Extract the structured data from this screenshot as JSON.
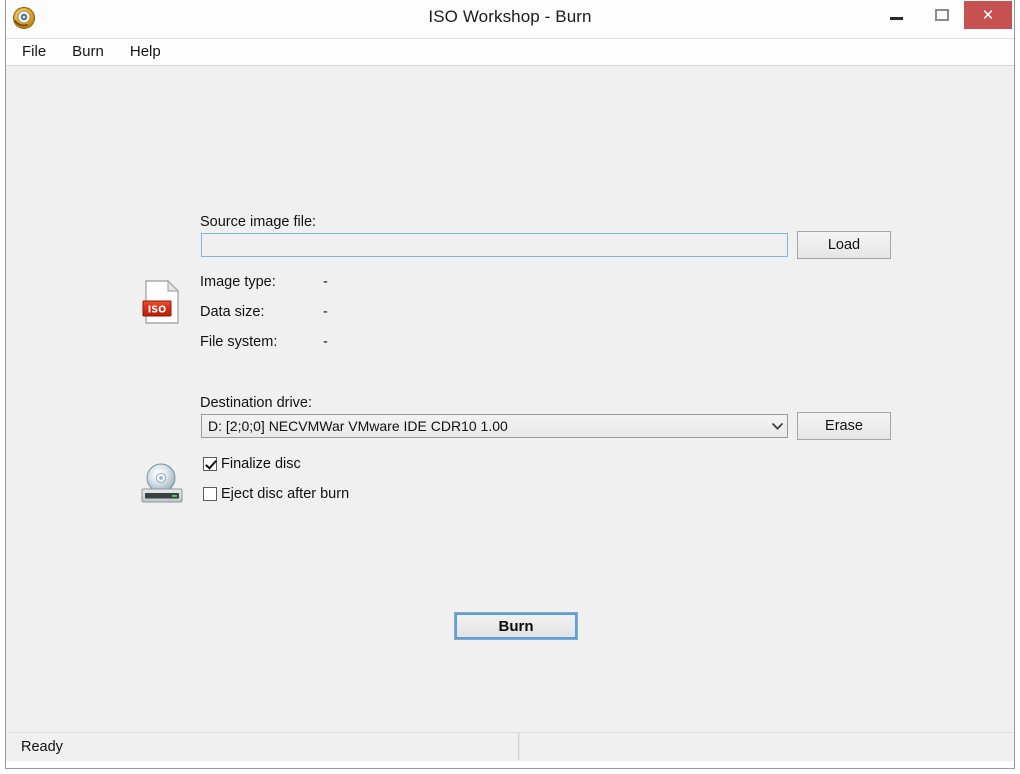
{
  "window": {
    "title": "ISO Workshop - Burn",
    "app_icon": "iso-workshop-logo-icon",
    "controls": {
      "minimize": "minimize-icon",
      "maximize": "maximize-icon",
      "close": "✕"
    },
    "close_button_color": "#c75050"
  },
  "menu": {
    "items": [
      {
        "label": "File"
      },
      {
        "label": "Burn"
      },
      {
        "label": "Help"
      }
    ]
  },
  "source": {
    "icon": "iso-file-icon",
    "label": "Source image file:",
    "input_value": "",
    "input_placeholder": "",
    "load_button": "Load",
    "info": [
      {
        "label": "Image type:",
        "value": "-"
      },
      {
        "label": "Data size:",
        "value": "-"
      },
      {
        "label": "File system:",
        "value": "-"
      }
    ]
  },
  "destination": {
    "icon": "cd-drive-icon",
    "label": "Destination drive:",
    "selected_drive": "D:  [2;0;0] NECVMWar VMware IDE CDR10 1.00",
    "dropdown_arrow": "⌄",
    "erase_button": "Erase",
    "options": [
      {
        "label": "Finalize disc",
        "checked": true
      },
      {
        "label": "Eject disc after burn",
        "checked": false
      }
    ]
  },
  "action": {
    "burn_button": "Burn"
  },
  "statusbar": {
    "text": "Ready",
    "panel2_text": ""
  },
  "colors": {
    "accent": "#5a9fe0",
    "close": "#c75050",
    "background": "#f0f0f0",
    "focus_border": "#7eb4e8"
  }
}
